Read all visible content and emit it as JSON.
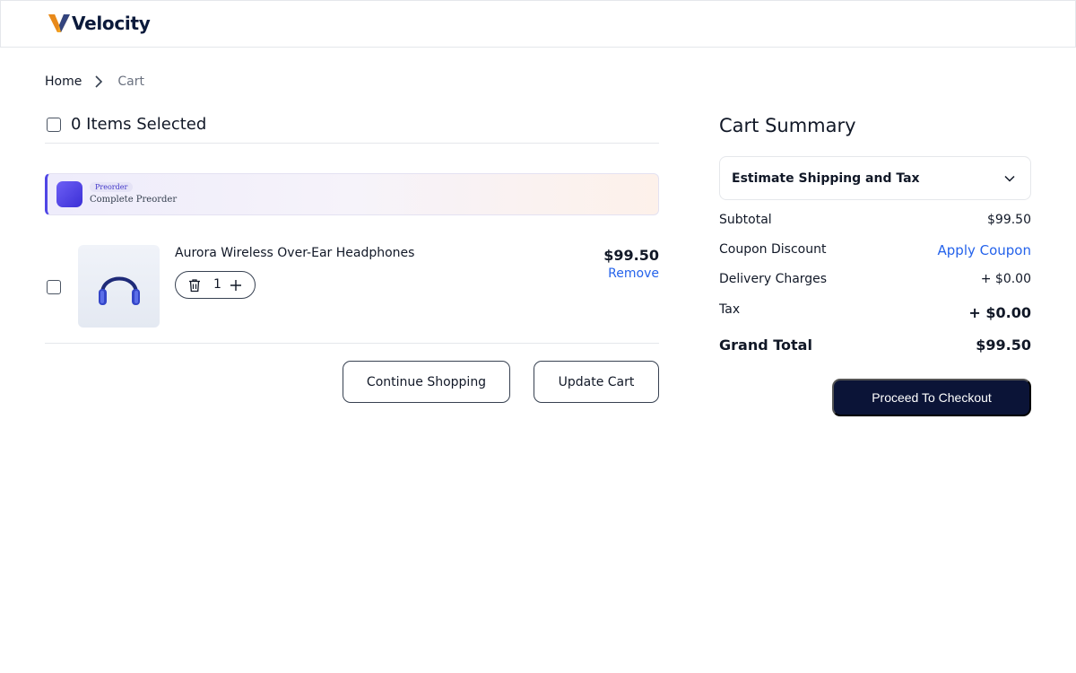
{
  "brand": {
    "name": "Velocity"
  },
  "breadcrumb": {
    "home": "Home",
    "current": "Cart"
  },
  "selection": {
    "label": "0 Items Selected",
    "selected_count": 0
  },
  "promo": {
    "tag": "Preorder",
    "text": "Complete  Preorder"
  },
  "cart": {
    "items": [
      {
        "name": "Aurora Wireless Over-Ear Headphones",
        "quantity": "1",
        "price": "$99.50",
        "remove_label": "Remove",
        "icon": "headphones-icon"
      }
    ]
  },
  "actions": {
    "continue_label": "Continue Shopping",
    "update_label": "Update Cart"
  },
  "summary": {
    "title": "Cart Summary",
    "estimate_label": "Estimate Shipping and Tax",
    "subtotal_label": "Subtotal",
    "subtotal_value": "$99.50",
    "coupon_label": "Coupon Discount",
    "coupon_action": "Apply Coupon",
    "delivery_label": "Delivery Charges",
    "delivery_value": "+ $0.00",
    "tax_label": "Tax",
    "tax_value": "+ $0.00",
    "grand_label": "Grand Total",
    "grand_value": "$99.50",
    "checkout_label": "Proceed To Checkout"
  },
  "colors": {
    "accent_blue": "#2563eb",
    "checkout_bg": "#0b1437",
    "logo_orange": "#f5a623",
    "promo_accent": "#4f46e5"
  }
}
